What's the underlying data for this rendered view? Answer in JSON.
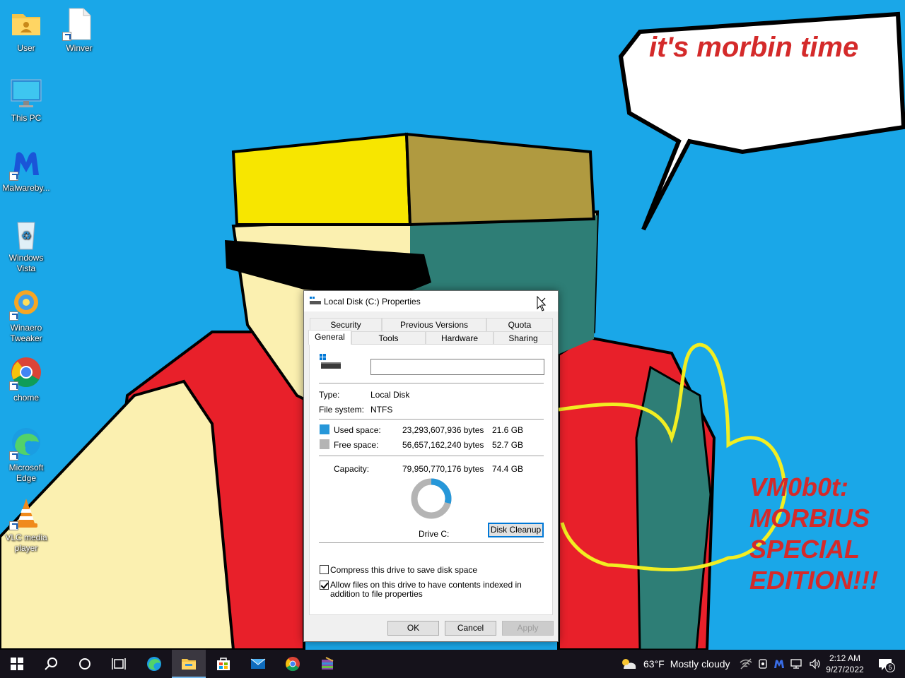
{
  "wallpaper": {
    "speech_text": "it's morbin time",
    "title_lines": [
      "VM0b0t:",
      "MORBIUS",
      "SPECIAL",
      "EDITION!!!"
    ]
  },
  "desktop": {
    "icons": [
      {
        "label": "User",
        "icon": "user-folder-icon"
      },
      {
        "label": "Winver",
        "icon": "document-icon"
      },
      {
        "label": "This PC",
        "icon": "monitor-icon"
      },
      {
        "label": "Malwareby...",
        "icon": "malwarebytes-icon"
      },
      {
        "label": "Windows Vista",
        "icon": "recycle-bin-icon"
      },
      {
        "label": "Winaero Tweaker",
        "icon": "winaero-tweaker-icon"
      },
      {
        "label": "chome",
        "icon": "chrome-icon"
      },
      {
        "label": "Microsoft Edge",
        "icon": "edge-icon"
      },
      {
        "label": "VLC media player",
        "icon": "vlc-icon"
      }
    ]
  },
  "dialog": {
    "title": "Local Disk (C:) Properties",
    "tabs_row1": [
      "Security",
      "Previous Versions",
      "Quota"
    ],
    "tabs_row2": [
      "General",
      "Tools",
      "Hardware",
      "Sharing"
    ],
    "active_tab": "General",
    "name_value": "",
    "type_label": "Type:",
    "type_value": "Local Disk",
    "fs_label": "File system:",
    "fs_value": "NTFS",
    "used_label": "Used space:",
    "used_bytes": "23,293,607,936 bytes",
    "used_gb": "21.6 GB",
    "free_label": "Free space:",
    "free_bytes": "56,657,162,240 bytes",
    "free_gb": "52.7 GB",
    "capacity_label": "Capacity:",
    "capacity_bytes": "79,950,770,176 bytes",
    "capacity_gb": "74.4 GB",
    "used_fraction": 0.291,
    "used_color": "#2697d9",
    "free_color": "#b4b4b4",
    "drive_label": "Drive C:",
    "cleanup_label": "Disk Cleanup",
    "compress_label": "Compress this drive to save disk space",
    "compress_checked": false,
    "index_label": "Allow files on this drive to have contents indexed in addition to file properties",
    "index_checked": true,
    "ok_label": "OK",
    "cancel_label": "Cancel",
    "apply_label": "Apply"
  },
  "taskbar": {
    "pinned": [
      "start-icon",
      "search-icon",
      "cortana-icon",
      "task-view-icon",
      "edge-icon",
      "file-explorer-icon",
      "store-icon",
      "mail-icon",
      "chrome-icon",
      "winrar-icon"
    ],
    "active": "file-explorer-icon",
    "weather_temp": "63°F",
    "weather_text": "Mostly cloudy",
    "time": "2:12 AM",
    "date": "9/27/2022",
    "notification_count": "5"
  }
}
